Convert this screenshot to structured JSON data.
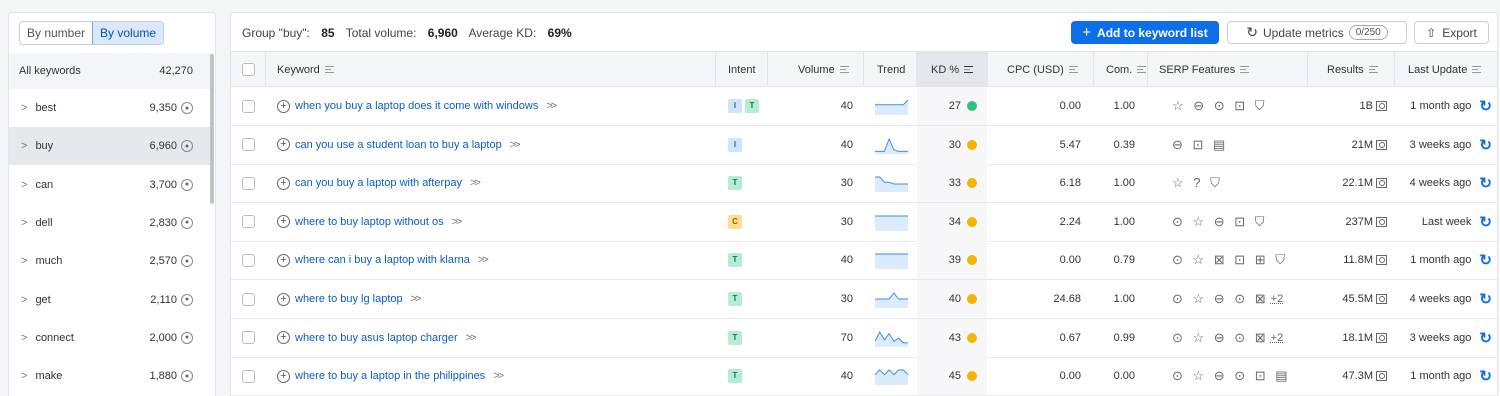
{
  "left_panel": {
    "toggle": [
      "By number",
      "By volume"
    ],
    "header": {
      "label": "All keywords",
      "count": "42,270"
    },
    "items": [
      {
        "label": "best",
        "count": "9,350"
      },
      {
        "label": "buy",
        "count": "6,960"
      },
      {
        "label": "can",
        "count": "3,700"
      },
      {
        "label": "dell",
        "count": "2,830"
      },
      {
        "label": "much",
        "count": "2,570"
      },
      {
        "label": "get",
        "count": "2,110"
      },
      {
        "label": "connect",
        "count": "2,000"
      },
      {
        "label": "make",
        "count": "1,880"
      }
    ]
  },
  "summary": {
    "group_label": "Group \"buy\":",
    "group_value": "85",
    "volume_label": "Total volume:",
    "volume_value": "6,960",
    "kd_label": "Average KD:",
    "kd_value": "69%"
  },
  "toolbar": {
    "add_label": "Add to keyword list",
    "update_label": "Update metrics",
    "update_count": "0/250",
    "export_label": "Export"
  },
  "columns": {
    "keyword": "Keyword",
    "intent": "Intent",
    "volume": "Volume",
    "trend": "Trend",
    "kd": "KD %",
    "cpc": "CPC (USD)",
    "com": "Com.",
    "serp": "SERP Features",
    "results": "Results",
    "last_update": "Last Update"
  },
  "colors": {
    "green": "#2ec27e",
    "amber": "#f4b400",
    "accent": "#0d6ee8"
  },
  "rows": [
    {
      "keyword": "when you buy a laptop does it come with windows",
      "intent": [
        "I",
        "T"
      ],
      "volume": "40",
      "trend": [
        2,
        2,
        2,
        2,
        2,
        2,
        2,
        3
      ],
      "kd": "27",
      "kd_color": "#2ec27e",
      "cpc": "0.00",
      "com": "1.00",
      "serp": "☆ ⊖ ⊙ ⊡ ⛉",
      "serp_more": "",
      "results": "1B",
      "last_update": "1 month ago"
    },
    {
      "keyword": "can you use a student loan to buy a laptop",
      "intent": [
        "I"
      ],
      "volume": "40",
      "trend": [
        1,
        1,
        1,
        9,
        2,
        1,
        1,
        1
      ],
      "kd": "30",
      "kd_color": "#f4b400",
      "cpc": "5.47",
      "com": "0.39",
      "serp": "⊖ ⊡ ▤",
      "serp_more": "",
      "results": "21M",
      "last_update": "3 weeks ago"
    },
    {
      "keyword": "can you buy a laptop with afterpay",
      "intent": [
        "T"
      ],
      "volume": "30",
      "trend": [
        8,
        8,
        5,
        5,
        4,
        4,
        4,
        4
      ],
      "kd": "33",
      "kd_color": "#f4b400",
      "cpc": "6.18",
      "com": "1.00",
      "serp": "☆ ? ⛉",
      "serp_more": "",
      "results": "22.1M",
      "last_update": "4 weeks ago"
    },
    {
      "keyword": "where to buy laptop without os",
      "intent": [
        "C"
      ],
      "volume": "30",
      "trend": [
        1,
        1,
        1,
        1,
        1,
        1,
        1,
        1
      ],
      "kd": "34",
      "kd_color": "#f4b400",
      "cpc": "2.24",
      "com": "1.00",
      "serp": "⊙ ☆ ⊖ ⊡ ⛉",
      "serp_more": "",
      "results": "237M",
      "last_update": "Last week"
    },
    {
      "keyword": "where can i buy a laptop with klarna",
      "intent": [
        "T"
      ],
      "volume": "40",
      "trend": [
        1,
        1,
        1,
        1,
        1,
        1,
        1,
        1
      ],
      "kd": "39",
      "kd_color": "#f4b400",
      "cpc": "0.00",
      "com": "0.79",
      "serp": "⊙ ☆ ⊠ ⊡ ⊞ ⛉",
      "serp_more": "",
      "results": "11.8M",
      "last_update": "1 month ago"
    },
    {
      "keyword": "where to buy lg laptop",
      "intent": [
        "T"
      ],
      "volume": "30",
      "trend": [
        4,
        4,
        4,
        4,
        7,
        4,
        4,
        4
      ],
      "kd": "40",
      "kd_color": "#f4b400",
      "cpc": "24.68",
      "com": "1.00",
      "serp": "⊙ ☆ ⊖ ⊙ ⊠",
      "serp_more": "+2",
      "results": "45.5M",
      "last_update": "4 weeks ago"
    },
    {
      "keyword": "where to buy asus laptop charger",
      "intent": [
        "T"
      ],
      "volume": "70",
      "trend": [
        3,
        9,
        4,
        8,
        3,
        5,
        2,
        2
      ],
      "kd": "43",
      "kd_color": "#f4b400",
      "cpc": "0.67",
      "com": "0.99",
      "serp": "⊙ ☆ ⊖ ⊙ ⊠",
      "serp_more": "+2",
      "results": "18.1M",
      "last_update": "3 weeks ago"
    },
    {
      "keyword": "where to buy a laptop in the philippines",
      "intent": [
        "T"
      ],
      "volume": "40",
      "trend": [
        2,
        3,
        2,
        3,
        2,
        3,
        3,
        2
      ],
      "kd": "45",
      "kd_color": "#f4b400",
      "cpc": "0.00",
      "com": "0.00",
      "serp": "⊙ ☆ ⊖ ⊙ ⊡ ▤",
      "serp_more": "",
      "results": "47.3M",
      "last_update": "1 month ago"
    }
  ]
}
